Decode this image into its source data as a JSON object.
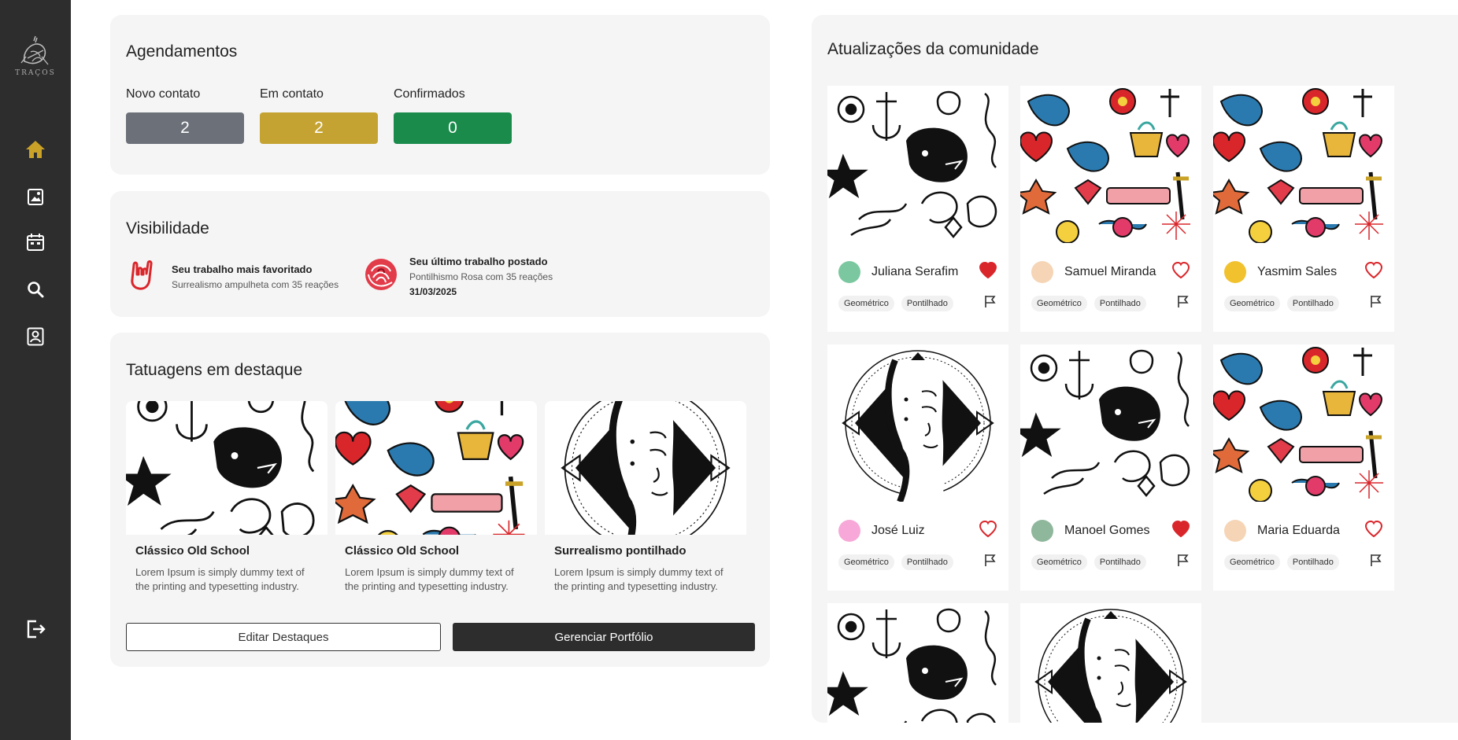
{
  "app": {
    "logo_text": "TRAÇOS"
  },
  "sidebar": {
    "items": [
      {
        "icon": "home-icon",
        "active": true
      },
      {
        "icon": "gallery-icon"
      },
      {
        "icon": "calendar-icon"
      },
      {
        "icon": "search-icon"
      },
      {
        "icon": "profile-icon"
      },
      {
        "icon": "logout-icon"
      }
    ],
    "active_color": "#c9a227"
  },
  "appointments": {
    "title": "Agendamentos",
    "items": [
      {
        "label": "Novo contato",
        "count": "2",
        "color": "#6b7079"
      },
      {
        "label": "Em contato",
        "count": "2",
        "color": "#c5a332"
      },
      {
        "label": "Confirmados",
        "count": "0",
        "color": "#1a8b4b"
      }
    ]
  },
  "visibility": {
    "title": "Visibilidade",
    "most_favorited": {
      "title": "Seu trabalho mais favoritado",
      "sub": "Surrealismo ampulheta com 35 reações"
    },
    "last_posted": {
      "title": "Seu último trabalho postado",
      "sub": "Pontilhismo Rosa com 35 reações",
      "date": "31/03/2025"
    }
  },
  "featured": {
    "title": "Tatuagens em destaque",
    "items": [
      {
        "title": "Clássico Old School",
        "desc": "Lorem Ipsum is simply dummy text of the printing and typesetting industry. Lorem Ipsum has been",
        "art": "bw"
      },
      {
        "title": "Clássico Old School",
        "desc": "Lorem Ipsum is simply dummy text of the printing and typesetting industry. Lorem Ipsum has been",
        "art": "color"
      },
      {
        "title": "Surrealismo pontilhado",
        "desc": "Lorem Ipsum is simply dummy text of the printing and typesetting industry. Lorem Ipsum has been",
        "art": "portrait"
      }
    ],
    "edit_label": "Editar Destaques",
    "manage_label": "Gerenciar Portfólio"
  },
  "community": {
    "title": "Atualizações da comunidade",
    "posts": [
      {
        "user": "Juliana Serafim",
        "liked": true,
        "tags": [
          "Geométrico",
          "Pontilhado"
        ],
        "art": "bw",
        "avatar": "#7bc8a0"
      },
      {
        "user": "Samuel Miranda",
        "liked": false,
        "tags": [
          "Geométrico",
          "Pontilhado"
        ],
        "art": "color",
        "avatar": "#f5d5b5"
      },
      {
        "user": "Yasmim Sales",
        "liked": false,
        "tags": [
          "Geométrico",
          "Pontilhado"
        ],
        "art": "color",
        "avatar": "#f2c12e"
      },
      {
        "user": "José Luiz",
        "liked": false,
        "tags": [
          "Geométrico",
          "Pontilhado"
        ],
        "art": "portrait",
        "avatar": "#f7a8d8"
      },
      {
        "user": "Manoel Gomes",
        "liked": true,
        "tags": [
          "Geométrico",
          "Pontilhado"
        ],
        "art": "bw",
        "avatar": "#8fb79c"
      },
      {
        "user": "Maria Eduarda",
        "liked": false,
        "tags": [
          "Geométrico",
          "Pontilhado"
        ],
        "art": "color",
        "avatar": "#f5d5b5"
      },
      {
        "art": "bw"
      },
      {
        "art": "portrait"
      }
    ]
  },
  "colors": {
    "like": "#d9262b",
    "dark": "#2d2d2d"
  }
}
